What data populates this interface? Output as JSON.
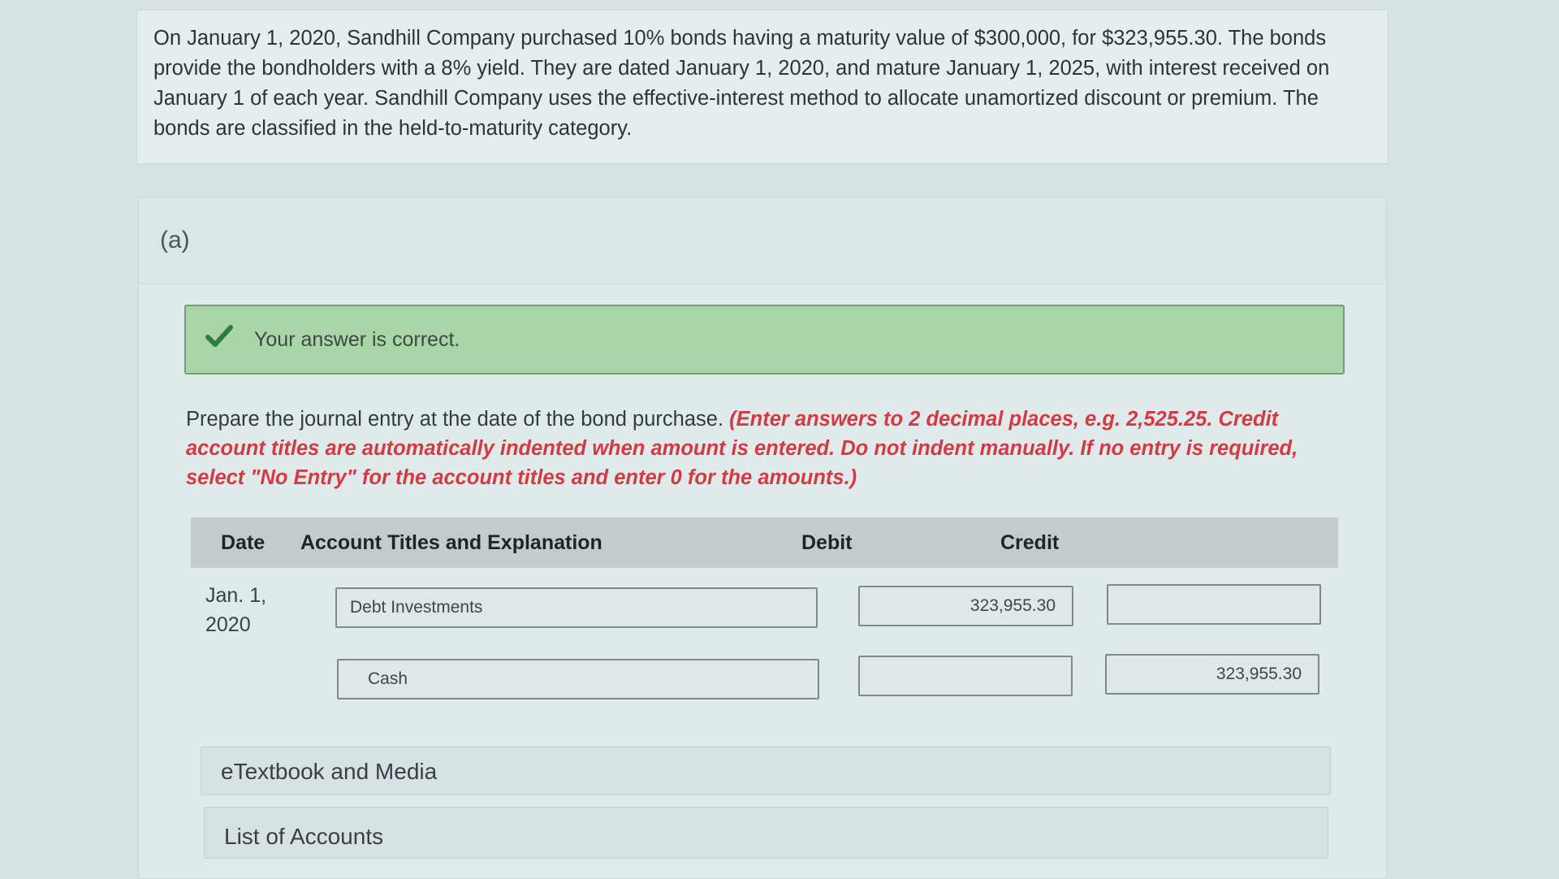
{
  "problem": {
    "text": "On January 1, 2020, Sandhill Company purchased 10% bonds having a maturity value of $300,000, for $323,955.30. The bonds provide the bondholders with a 8% yield. They are dated January 1, 2020, and mature January 1, 2025, with interest received on January 1 of each year. Sandhill Company uses the effective-interest method to allocate unamortized discount or premium. The bonds are classified in the held-to-maturity category."
  },
  "part": {
    "label": "(a)",
    "feedback": "Your answer is correct.",
    "instructions_plain": "Prepare the journal entry at the date of the bond purchase. ",
    "instructions_red": "(Enter answers to 2 decimal places, e.g. 2,525.25. Credit account titles are automatically indented when amount is entered. Do not indent manually. If no entry is required, select \"No Entry\" for the account titles and enter 0 for the amounts.)"
  },
  "journal": {
    "headers": {
      "date": "Date",
      "account": "Account Titles and Explanation",
      "debit": "Debit",
      "credit": "Credit"
    },
    "date_line1": "Jan. 1,",
    "date_line2": "2020",
    "rows": [
      {
        "account": "Debt Investments",
        "debit": "323,955.30",
        "credit": ""
      },
      {
        "account": "Cash",
        "debit": "",
        "credit": "323,955.30"
      }
    ]
  },
  "links": {
    "etextbook": "eTextbook and Media",
    "accounts": "List of Accounts"
  },
  "colors": {
    "feedback_bg": "#a9d5a9",
    "check": "#2f7d3a",
    "instruction_red": "#d23a44"
  },
  "icons": {
    "feedback": "check-icon"
  }
}
